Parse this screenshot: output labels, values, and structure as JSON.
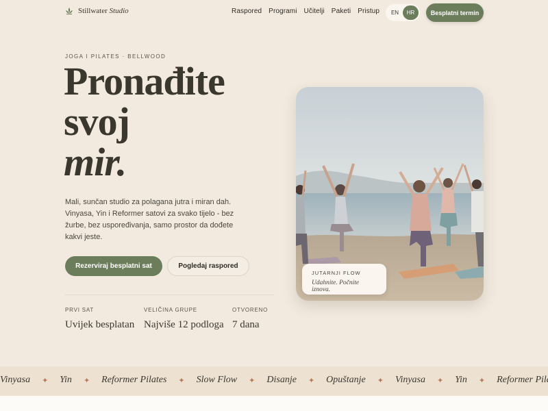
{
  "header": {
    "logo_name": "Stillwater",
    "logo_suffix": "Studio",
    "nav": [
      "Raspored",
      "Programi",
      "Učitelji",
      "Paketi",
      "Pristup"
    ],
    "lang_options": [
      "EN",
      "HR"
    ],
    "active_lang": "HR",
    "cta_label": "Besplatni termin"
  },
  "hero": {
    "eyebrow": "JOGA I PILATES · BELLWOOD",
    "headline_line1": "Pronađite",
    "headline_line2": "svoj",
    "headline_line3": "mir.",
    "intro": "Mali, sunčan studio za polagana jutra i miran dah. Vinyasa, Yin i Reformer satovi za svako tijelo - bez žurbe, bez uspoređivanja, samo prostor da dođete kakvi jeste.",
    "primary_button": "Rezerviraj besplatni sat",
    "secondary_button": "Pogledaj raspored"
  },
  "stats": [
    {
      "label": "PRVI SAT",
      "value": "Uvijek besplatan"
    },
    {
      "label": "VELIČINA GRUPE",
      "value": "Najviše 12 podloga"
    },
    {
      "label": "OTVORENO",
      "value": "7 dana"
    }
  ],
  "photo_card": {
    "title": "JUTARNJI FLOW",
    "subtitle": "Udahnite. Počnite iznova."
  },
  "marquee": [
    "Vinyasa",
    "Yin",
    "Reformer Pilates",
    "Slow Flow",
    "Disanje",
    "Opuštanje",
    "Vinyasa",
    "Yin",
    "Reformer Pilates"
  ],
  "colors": {
    "background": "#f2eadf",
    "accent": "#6b7d5b",
    "separator": "#b57a5a",
    "text": "#3a372f"
  },
  "icons": {
    "logo": "lotus-icon",
    "separator": "sparkle-icon"
  }
}
